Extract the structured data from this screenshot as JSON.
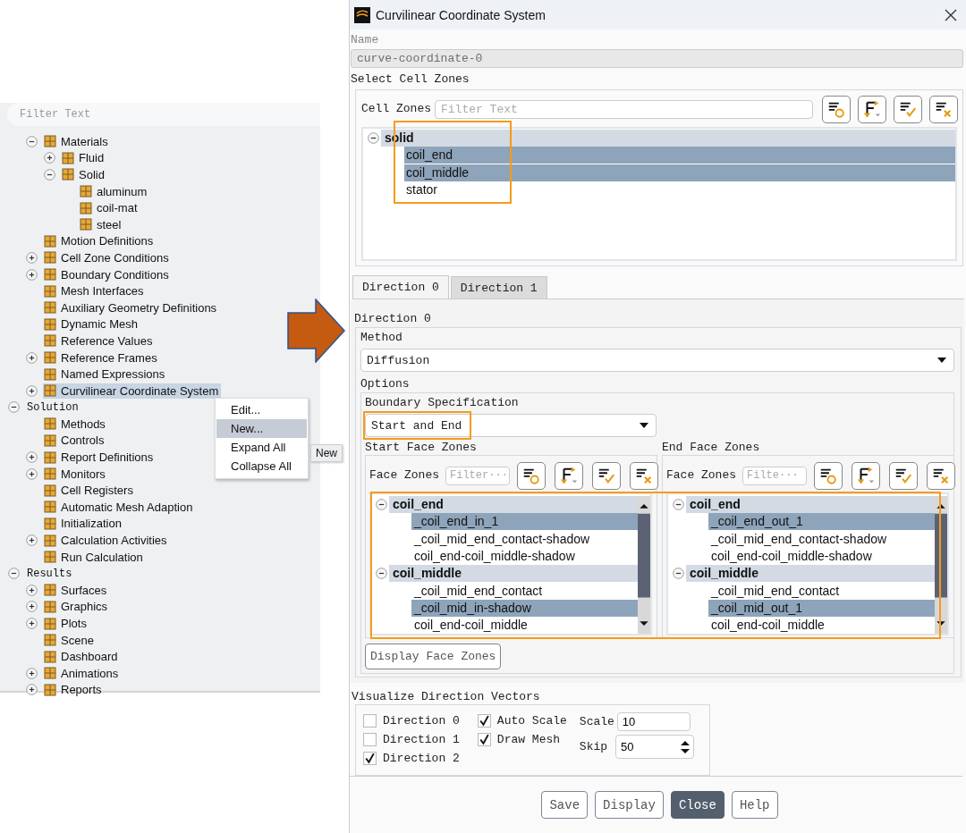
{
  "tree_panel": {
    "filter": {
      "placeholder": "Filter Text"
    },
    "tree": [
      {
        "kind": "item",
        "label": "Materials",
        "expanded": true,
        "selected": false,
        "children": [
          {
            "kind": "item",
            "label": "Fluid",
            "expanded": false,
            "selected": false
          },
          {
            "kind": "item",
            "label": "Solid",
            "expanded": true,
            "selected": false,
            "children": [
              {
                "kind": "item",
                "label": "aluminum",
                "selected": false
              },
              {
                "kind": "item",
                "label": "coil-mat",
                "selected": false
              },
              {
                "kind": "item",
                "label": "steel",
                "selected": false
              }
            ]
          }
        ]
      },
      {
        "kind": "item",
        "label": "Motion Definitions",
        "selected": false
      },
      {
        "kind": "item",
        "label": "Cell Zone Conditions",
        "expanded": false,
        "selected": false
      },
      {
        "kind": "item",
        "label": "Boundary Conditions",
        "expanded": false,
        "selected": false
      },
      {
        "kind": "item",
        "label": "Mesh Interfaces",
        "selected": false
      },
      {
        "kind": "item",
        "label": "Auxiliary Geometry Definitions",
        "selected": false
      },
      {
        "kind": "item",
        "label": "Dynamic Mesh",
        "selected": false
      },
      {
        "kind": "item",
        "label": "Reference Values",
        "selected": false
      },
      {
        "kind": "item",
        "label": "Reference Frames",
        "expanded": false,
        "selected": false
      },
      {
        "kind": "item",
        "label": "Named Expressions",
        "selected": false
      },
      {
        "kind": "item",
        "label": "Curvilinear Coordinate System",
        "expanded": false,
        "selected": true
      },
      {
        "kind": "section",
        "label": "Solution",
        "expanded": true,
        "selected": false,
        "children": [
          {
            "kind": "item",
            "label": "Methods",
            "selected": false
          },
          {
            "kind": "item",
            "label": "Controls",
            "selected": false
          },
          {
            "kind": "item",
            "label": "Report Definitions",
            "expanded": false,
            "selected": false
          },
          {
            "kind": "item",
            "label": "Monitors",
            "expanded": false,
            "selected": false
          },
          {
            "kind": "item",
            "label": "Cell Registers",
            "selected": false
          },
          {
            "kind": "item",
            "label": "Automatic Mesh Adaption",
            "selected": false
          },
          {
            "kind": "item",
            "label": "Initialization",
            "selected": false
          },
          {
            "kind": "item",
            "label": "Calculation Activities",
            "expanded": false,
            "selected": false
          },
          {
            "kind": "item",
            "label": "Run Calculation",
            "selected": false
          }
        ]
      },
      {
        "kind": "section",
        "label": "Results",
        "expanded": true,
        "selected": false,
        "children": [
          {
            "kind": "item",
            "label": "Surfaces",
            "expanded": false,
            "selected": false
          },
          {
            "kind": "item",
            "label": "Graphics",
            "expanded": false,
            "selected": false
          },
          {
            "kind": "item",
            "label": "Plots",
            "expanded": false,
            "selected": false
          },
          {
            "kind": "item",
            "label": "Scene",
            "selected": false
          },
          {
            "kind": "item",
            "label": "Dashboard",
            "selected": false
          },
          {
            "kind": "item",
            "label": "Animations",
            "expanded": false,
            "selected": false
          },
          {
            "kind": "item",
            "label": "Reports",
            "expanded": false,
            "selected": false
          }
        ]
      }
    ],
    "context_menu": {
      "items": [
        {
          "label": "Edit...",
          "selected": false
        },
        {
          "label": "New...",
          "selected": true
        },
        {
          "label": "Expand All",
          "selected": false
        },
        {
          "label": "Collapse All",
          "selected": false
        }
      ],
      "tooltip": "New"
    }
  },
  "dialog": {
    "title": "Curvilinear Coordinate System",
    "name": {
      "label": "Name",
      "value": "curve-coordinate-0",
      "disabled": true
    },
    "cell_zones": {
      "title": "Select Cell Zones",
      "label": "Cell Zones",
      "filter": {
        "placeholder": "Filter Text"
      },
      "groups": [
        {
          "label": "solid",
          "expanded": true,
          "items": [
            {
              "label": "coil_end",
              "selected": true
            },
            {
              "label": "coil_middle",
              "selected": true
            },
            {
              "label": "stator",
              "selected": false
            }
          ]
        }
      ]
    },
    "tabs": [
      {
        "label": "Direction 0",
        "selected": true
      },
      {
        "label": "Direction 1",
        "selected": false
      }
    ],
    "direction": {
      "title": "Direction 0",
      "method": {
        "label": "Method",
        "value": "Diffusion"
      },
      "options_label": "Options",
      "boundary": {
        "label": "Boundary Specification",
        "value": "Start and End"
      },
      "face_panels": [
        {
          "title": "Start Face Zones",
          "label": "Face Zones",
          "filter": {
            "placeholder": "Filter···"
          },
          "groups": [
            {
              "label": "coil_end",
              "expanded": true,
              "items": [
                {
                  "label": "_coil_end_in_1",
                  "selected": true
                },
                {
                  "label": "_coil_mid_end_contact-shadow",
                  "selected": false
                },
                {
                  "label": "coil_end-coil_middle-shadow",
                  "selected": false
                }
              ]
            },
            {
              "label": "coil_middle",
              "expanded": true,
              "items": [
                {
                  "label": "_coil_mid_end_contact",
                  "selected": false
                },
                {
                  "label": "_coil_mid_in-shadow",
                  "selected": true
                },
                {
                  "label": "coil_end-coil_middle",
                  "selected": false
                }
              ]
            }
          ]
        },
        {
          "title": "End Face Zones",
          "label": "Face Zones",
          "filter": {
            "placeholder": "Filte···"
          },
          "groups": [
            {
              "label": "coil_end",
              "expanded": true,
              "items": [
                {
                  "label": "_coil_end_out_1",
                  "selected": true
                },
                {
                  "label": "_coil_mid_end_contact-shadow",
                  "selected": false
                },
                {
                  "label": "coil_end-coil_middle-shadow",
                  "selected": false
                }
              ]
            },
            {
              "label": "coil_middle",
              "expanded": true,
              "items": [
                {
                  "label": "_coil_mid_end_contact",
                  "selected": false
                },
                {
                  "label": "_coil_mid_out_1",
                  "selected": true
                },
                {
                  "label": "coil_end-coil_middle",
                  "selected": false
                }
              ]
            }
          ]
        }
      ],
      "display_button": "Display Face Zones"
    },
    "visualize": {
      "title": "Visualize Direction Vectors",
      "directions": [
        {
          "label": "Direction 0",
          "checked": false
        },
        {
          "label": "Direction 1",
          "checked": false
        },
        {
          "label": "Direction 2",
          "checked": true
        }
      ],
      "display_options": [
        {
          "label": "Auto Scale",
          "checked": true
        },
        {
          "label": "Draw Mesh",
          "checked": true
        }
      ],
      "scale": {
        "label": "Scale",
        "value": "10"
      },
      "skip": {
        "label": "Skip",
        "value": "50"
      }
    },
    "buttons": [
      {
        "label": "Save",
        "default": false
      },
      {
        "label": "Display",
        "default": false
      },
      {
        "label": "Close",
        "default": true
      },
      {
        "label": "Help",
        "default": false
      }
    ]
  }
}
